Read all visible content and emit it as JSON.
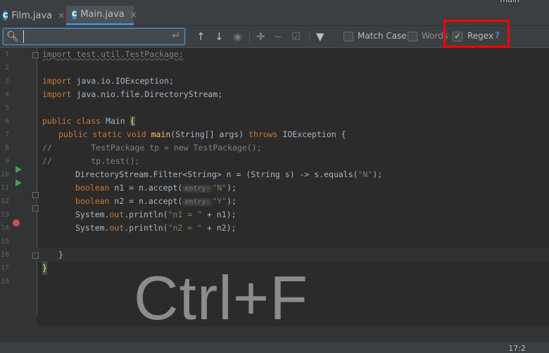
{
  "top_label": "main",
  "tabs": [
    {
      "label": "Film.java",
      "close": "×"
    },
    {
      "label": "Main.java",
      "close": "×"
    }
  ],
  "find": {
    "value": "",
    "match_case": "Match Case",
    "words": "Words",
    "regex": "Regex",
    "regex_checked": true,
    "help": "?"
  },
  "line_numbers": [
    "1",
    "2",
    "3",
    "4",
    "5",
    "6",
    "7",
    "8",
    "9",
    "10",
    "11",
    "12",
    "13",
    "14",
    "15",
    "16",
    "17",
    "18"
  ],
  "code": {
    "l1": "import test.util.TestPackage;",
    "l3_kw": "import",
    "l3": " java.io.IOException;",
    "l4_kw": "import",
    "l4": " java.nio.file.DirectoryStream;",
    "l6_kw": "public class",
    "l6": " Main ",
    "l6_brace": "{",
    "l7_kw": "public static void",
    "l7_fn": "main",
    "l7a": "(String[] args) ",
    "l7_kw2": "throws",
    "l7b": " IOException {",
    "l8": "//        TestPackage tp = new TestPackage();",
    "l9": "//        tp.test();",
    "l10a": "DirectoryStream.Filter<String> n = (String s) -> s.equals(",
    "l10_str": "\"N\"",
    "l10b": ");",
    "l11_kw": "boolean",
    "l11a": " n1 = n.accept(",
    "l11_hint": "entry:",
    "l11_str": "\"N\"",
    "l11b": ");",
    "l12_kw": "boolean",
    "l12a": " n2 = n.accept(",
    "l12_hint": "entry:",
    "l12_str": "\"Y\"",
    "l12b": ");",
    "l13a": "System.",
    "l13_kw": "out",
    "l13b": ".println(",
    "l13_str": "\"n1 = \"",
    "l13c": " + n1);",
    "l14a": "System.",
    "l14_kw": "out",
    "l14b": ".println(",
    "l14_str": "\"n2 = \"",
    "l14c": " + n2);",
    "l16": "}",
    "l17": "}"
  },
  "overlay": "Ctrl+F",
  "status": {
    "position": "17:2"
  }
}
